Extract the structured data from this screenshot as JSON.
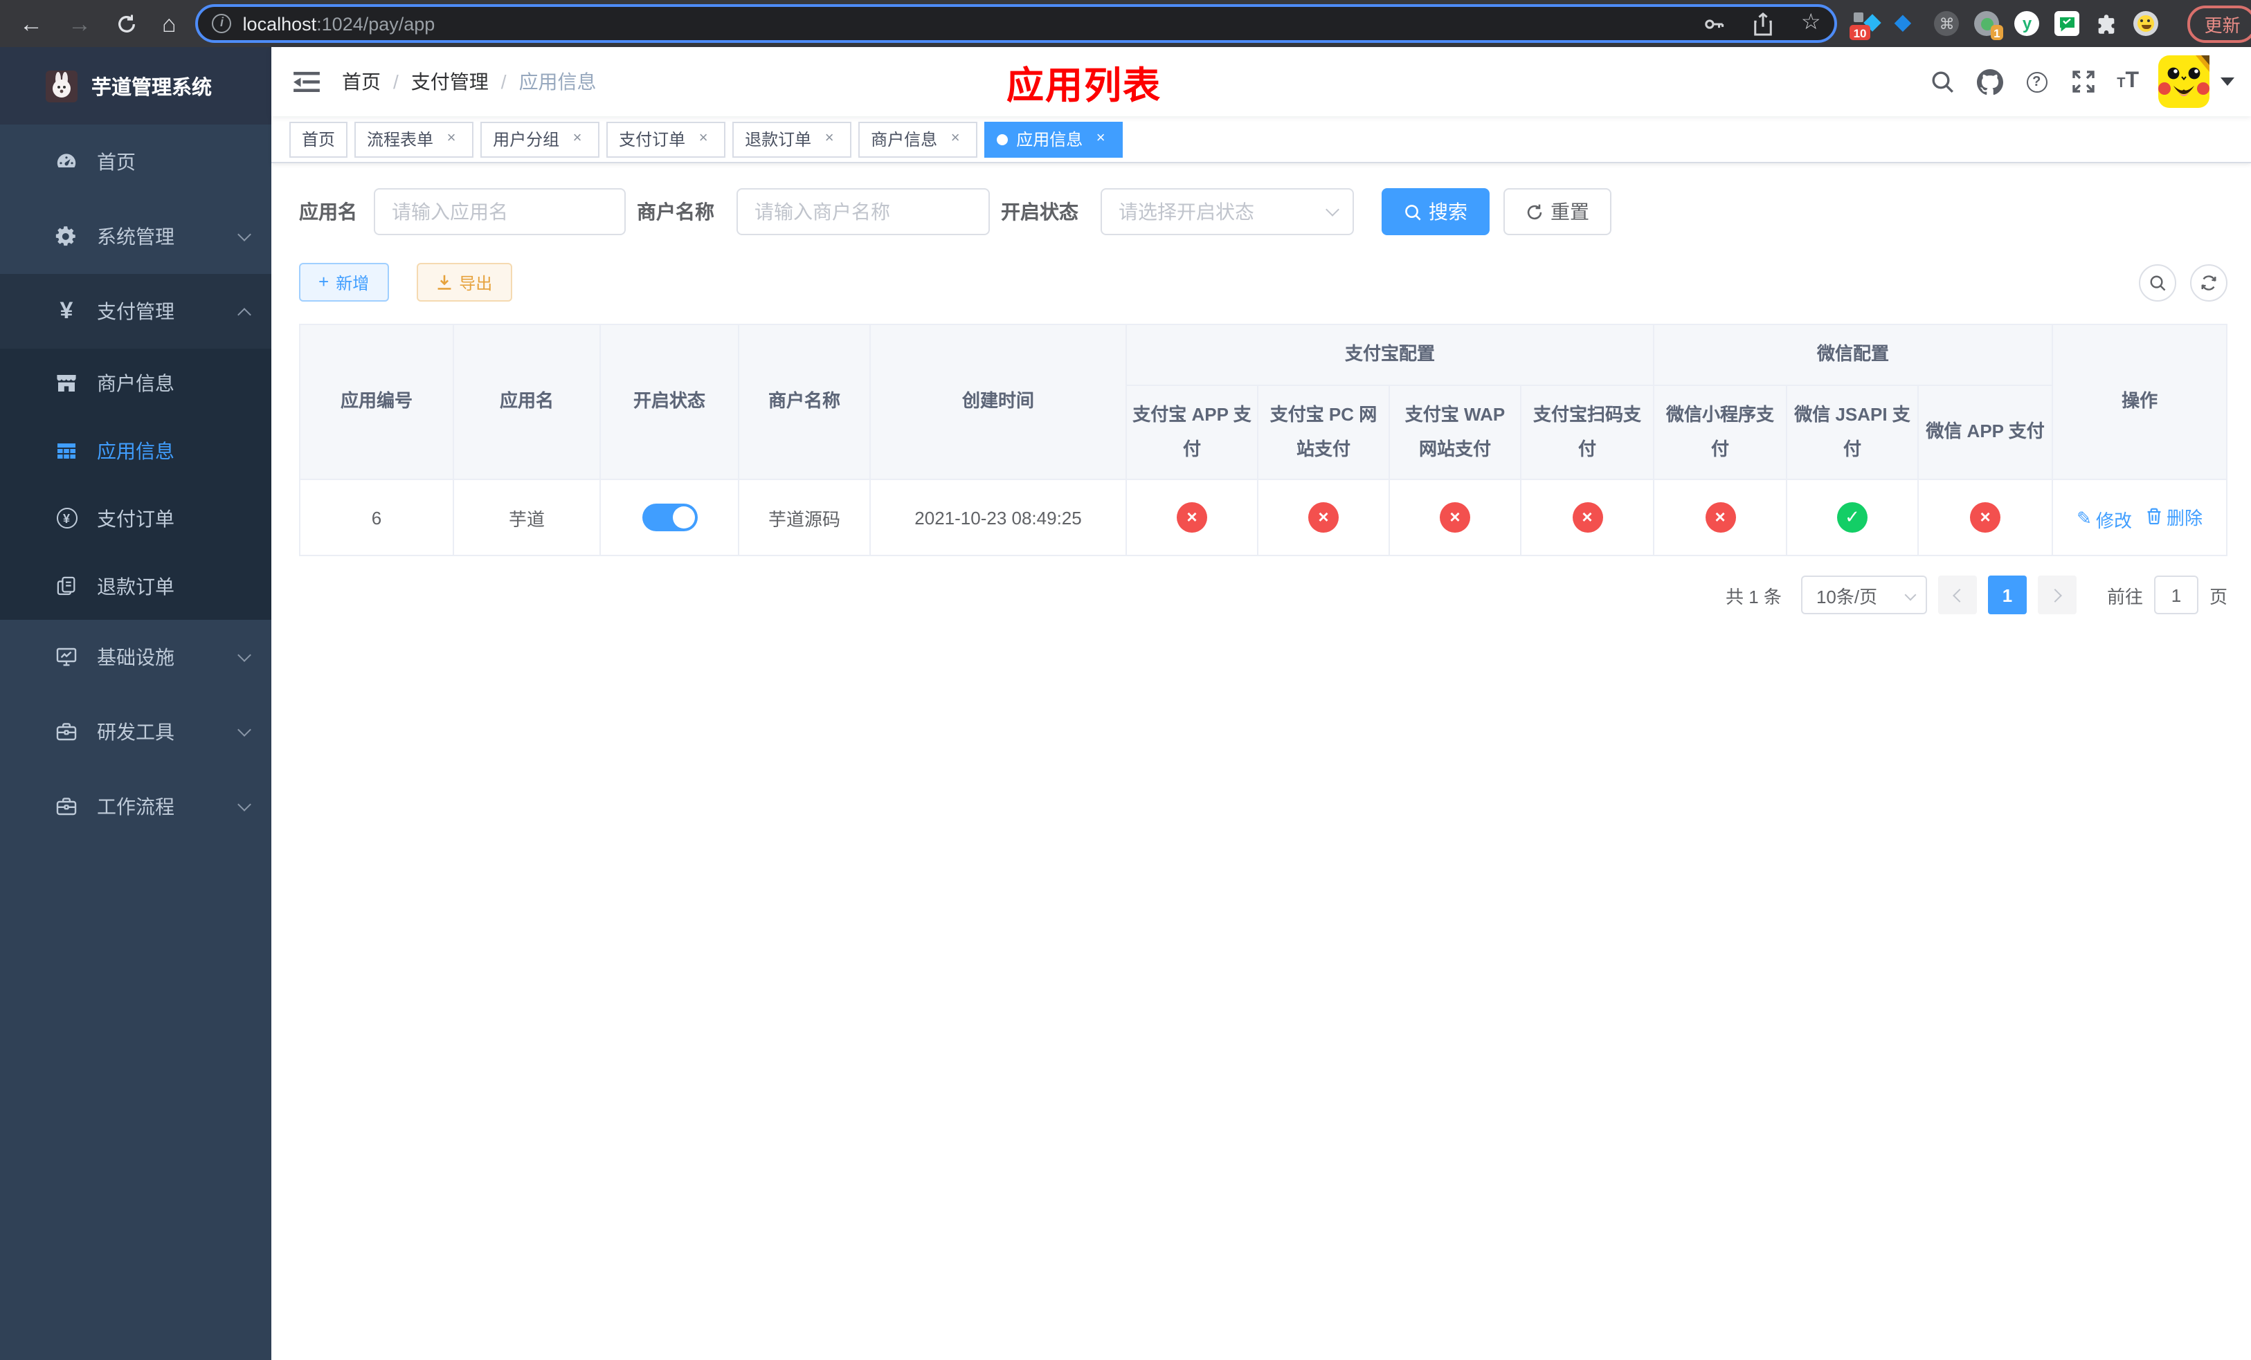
{
  "colors": {
    "primary": "#409eff",
    "danger": "#f3504e",
    "success": "#13ce66",
    "warning": "#e6a23c",
    "annotation": "#fd0000",
    "sidebar-bg": "#304156",
    "submenu-bg": "#1f2d3d",
    "sidebar-text": "#bfcbd9"
  },
  "browser": {
    "url": {
      "host": "localhost",
      "rest": ":1024/pay/app"
    },
    "update_label": "更新",
    "badges": {
      "collector": "10",
      "session": "1"
    },
    "yuque_letter": "y"
  },
  "sidebar": {
    "app_title": "芋道管理系统",
    "menu": [
      {
        "label": "首页"
      },
      {
        "label": "系统管理"
      },
      {
        "label": "支付管理"
      },
      {
        "label": "商户信息"
      },
      {
        "label": "应用信息"
      },
      {
        "label": "支付订单"
      },
      {
        "label": "退款订单"
      },
      {
        "label": "基础设施"
      },
      {
        "label": "研发工具"
      },
      {
        "label": "工作流程"
      }
    ]
  },
  "navbar": {
    "breadcrumb": [
      {
        "label": "首页"
      },
      {
        "label": "支付管理"
      },
      {
        "label": "应用信息"
      }
    ],
    "annotation": "应用列表"
  },
  "tabs": [
    {
      "label": "首页"
    },
    {
      "label": "流程表单"
    },
    {
      "label": "用户分组"
    },
    {
      "label": "支付订单"
    },
    {
      "label": "退款订单"
    },
    {
      "label": "商户信息"
    },
    {
      "label": "应用信息"
    }
  ],
  "filters": {
    "app_name": {
      "label": "应用名",
      "placeholder": "请输入应用名"
    },
    "merchant_name": {
      "label": "商户名称",
      "placeholder": "请输入商户名称"
    },
    "status": {
      "label": "开启状态",
      "placeholder": "请选择开启状态"
    },
    "search_label": "搜索",
    "reset_label": "重置"
  },
  "toolbar": {
    "add_label": "新增",
    "export_label": "导出"
  },
  "table": {
    "columns": [
      "应用编号",
      "应用名",
      "开启状态",
      "商户名称",
      "创建时间"
    ],
    "groups": {
      "alipay": "支付宝配置",
      "wechat": "微信配置"
    },
    "pay_columns": [
      "支付宝 APP 支付",
      "支付宝 PC 网站支付",
      "支付宝 WAP 网站支付",
      "支付宝扫码支付",
      "微信小程序支付",
      "微信 JSAPI 支付",
      "微信 APP 支付"
    ],
    "action_column": "操作",
    "row": {
      "id": "6",
      "name": "芋道",
      "status_on": true,
      "merchant": "芋道源码",
      "create_time": "2021-10-23 08:49:25",
      "pay_status": [
        "fail",
        "fail",
        "fail",
        "fail",
        "fail",
        "success",
        "fail"
      ],
      "edit_label": "修改",
      "delete_label": "删除"
    }
  },
  "pagination": {
    "total_text": "共 1 条",
    "page_size": "10条/页",
    "current_page": "1",
    "goto_label": "前往",
    "goto_value": "1",
    "page_unit": "页"
  }
}
